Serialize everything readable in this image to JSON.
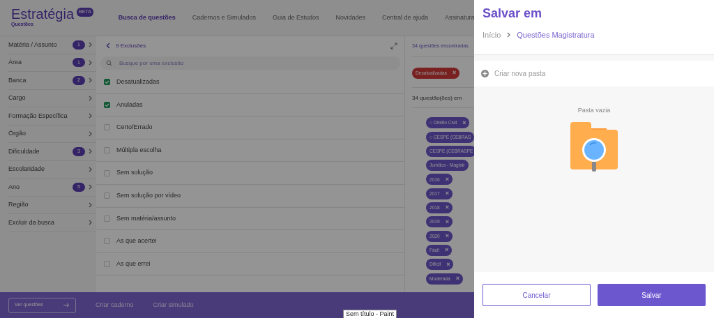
{
  "header": {
    "logo": "Estratégia",
    "logo_sub": "Questões",
    "beta": "BETA",
    "nav": [
      {
        "label": "Busca de questões",
        "selected": true
      },
      {
        "label": "Cadernos e Simulados",
        "selected": false
      },
      {
        "label": "Guia de Estudos",
        "selected": false
      },
      {
        "label": "Novidades",
        "selected": false
      },
      {
        "label": "Central de ajuda",
        "selected": false
      },
      {
        "label": "Assinatura",
        "selected": false
      }
    ]
  },
  "sidebar": {
    "items": [
      {
        "label": "Matéria / Assunto",
        "count": "1"
      },
      {
        "label": "Área",
        "count": "1"
      },
      {
        "label": "Banca",
        "count": "2"
      },
      {
        "label": "Cargo"
      },
      {
        "label": "Formação Específica"
      },
      {
        "label": "Órgão"
      },
      {
        "label": "Dificuldade",
        "count": "3"
      },
      {
        "label": "Escolaridade"
      },
      {
        "label": "Ano",
        "count": "5"
      },
      {
        "label": "Região"
      },
      {
        "label": "Excluir da busca"
      }
    ]
  },
  "exclusions": {
    "title": "9 Exclusões",
    "search_placeholder": "Busque por uma exclusão",
    "options": [
      {
        "label": "Desatualizadas",
        "checked": true
      },
      {
        "label": "Anuladas",
        "checked": true
      },
      {
        "label": "Certo/Errado",
        "checked": false
      },
      {
        "label": "Múltipla escolha",
        "checked": false
      },
      {
        "label": "Sem solução",
        "checked": false
      },
      {
        "label": "Sem solução por vídeo",
        "checked": false
      },
      {
        "label": "Sem matéria/assunto",
        "checked": false
      },
      {
        "label": "As que acertei",
        "checked": false
      },
      {
        "label": "As que errei",
        "checked": false
      }
    ]
  },
  "results": {
    "found": "34 questões encontradas",
    "exclusion_tags": [
      {
        "label": "Desatualizadas",
        "close": "×"
      }
    ],
    "count": "34 questão(ões) em",
    "filter_tags": [
      {
        "label": "○ Direito Civil",
        "close": "×"
      },
      {
        "label": "○ CESPE (CEBRAS"
      },
      {
        "label": "CESPE (CEBRASPE"
      },
      {
        "label": "Jurídica - Magistr"
      },
      {
        "label": "2016",
        "close": "×"
      },
      {
        "label": "2017",
        "close": "×"
      },
      {
        "label": "2018",
        "close": "×"
      },
      {
        "label": "2019",
        "close": "×"
      },
      {
        "label": "2020",
        "close": "×"
      },
      {
        "label": "Fácil",
        "close": "×"
      },
      {
        "label": "Difícil",
        "close": "×"
      },
      {
        "label": "Moderada",
        "close": "×"
      }
    ]
  },
  "bottom_bar": {
    "primary": "Ver questões",
    "links": [
      "Criar caderno",
      "Criar simulado"
    ]
  },
  "tooltip": "Sem título - Paint",
  "drawer": {
    "title": "Salvar em",
    "breadcrumb": [
      {
        "label": "Início",
        "selected": false
      },
      {
        "label": "Questões Magistratura",
        "selected": true
      }
    ],
    "new_folder": "Criar nova pasta",
    "empty": "Pasta vazia",
    "buttons": [
      {
        "label": "Cancelar",
        "kind": "outline"
      },
      {
        "label": "Salvar",
        "kind": "primary"
      }
    ]
  }
}
